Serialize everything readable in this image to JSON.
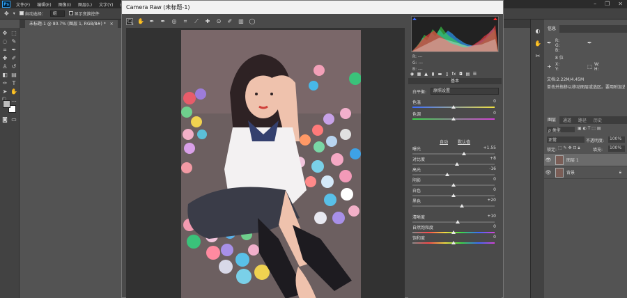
{
  "menubar": {
    "items": [
      "文件(F)",
      "编辑(E)",
      "图像(I)",
      "图层(L)",
      "文字(Y)",
      "选择(S)",
      "滤"
    ],
    "logo": "Ps"
  },
  "optbar": {
    "auto_select_label": "自动选择：",
    "auto_select_value": "组",
    "show_transform_label": "显示变换控件"
  },
  "tabs": {
    "doc_tab": "未标题-1 @ 80.7% (图层 1, RGB/8#) *",
    "doc_tab_close": "×"
  },
  "dialog": {
    "title": "Camera Raw (未标题-1)"
  },
  "histogram": {
    "rgb": [
      "R: ---",
      "G: ---",
      "B: ---"
    ]
  },
  "basic_panel": {
    "header": "基本",
    "wb_label": "白平衡:",
    "wb_value": "原照设置",
    "auto_label": "自动",
    "default_label": "默认值",
    "sliders": [
      {
        "label": "色温",
        "value": "0",
        "pos": 0.5
      },
      {
        "label": "色调",
        "value": "0",
        "pos": 0.5
      },
      {
        "label": "曝光",
        "value": "+1.55",
        "pos": 0.63
      },
      {
        "label": "对比度",
        "value": "+8",
        "pos": 0.54
      },
      {
        "label": "高光",
        "value": "-16",
        "pos": 0.42
      },
      {
        "label": "阴影",
        "value": "0",
        "pos": 0.5
      },
      {
        "label": "白色",
        "value": "0",
        "pos": 0.5
      },
      {
        "label": "黑色",
        "value": "+20",
        "pos": 0.6
      },
      {
        "label": "清晰度",
        "value": "+10",
        "pos": 0.55
      },
      {
        "label": "自然饱和度",
        "value": "0",
        "pos": 0.5
      },
      {
        "label": "饱和度",
        "value": "0",
        "pos": 0.5
      }
    ]
  },
  "info_panel": {
    "tabs": [
      "信息"
    ],
    "rows": [
      "R:",
      "G:",
      "B:",
      "8 位",
      "X:",
      "Y:",
      "W:",
      "H:"
    ],
    "doc_size": "文档:2.22M/4.45M",
    "hint": "单击并拖移以移动图层或选区。要用附加选项，使用 Shift, Alt 和 Ctrl 键。"
  },
  "layers_panel": {
    "tabs": [
      "图层",
      "通道",
      "路径",
      "历史"
    ],
    "kind_label": "ρ 类型",
    "blend_mode": "正常",
    "opacity_label": "不透明度:",
    "opacity_value": "100%",
    "lock_label": "锁定:",
    "fill_label": "填充:",
    "fill_value": "100%",
    "layers": [
      {
        "name": "图层 1",
        "selected": true
      },
      {
        "name": "背景",
        "selected": false
      }
    ]
  }
}
